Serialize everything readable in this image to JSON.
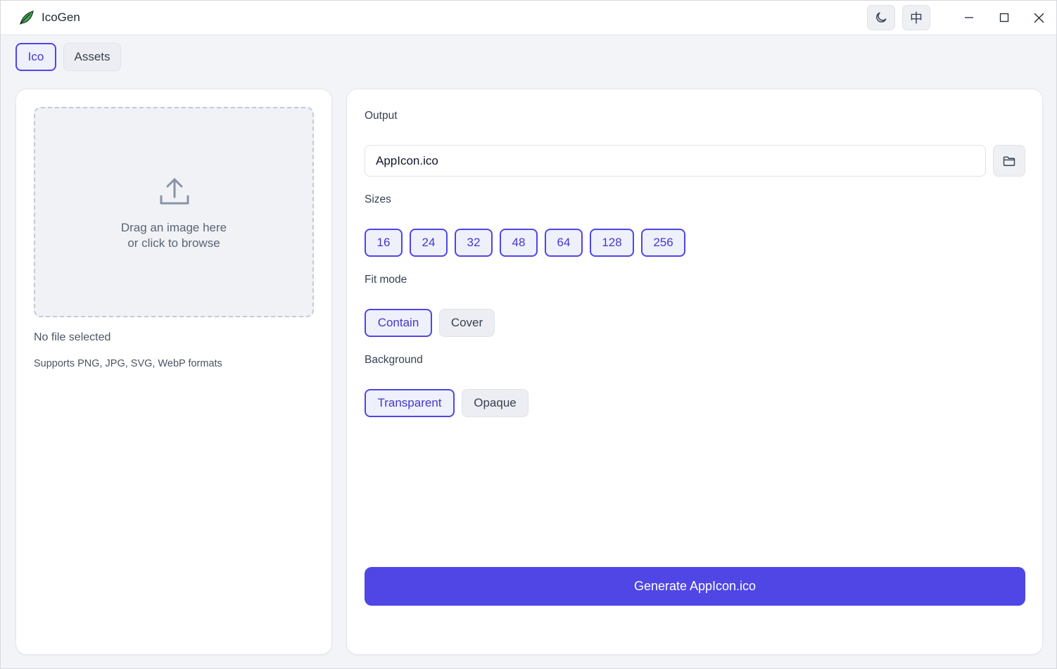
{
  "app": {
    "title": "IcoGen",
    "logo_icon": "leaf-icon",
    "lang_label": "中",
    "theme_icon": "moon-icon"
  },
  "tabs": [
    {
      "label": "Ico",
      "active": true
    },
    {
      "label": "Assets",
      "active": false
    }
  ],
  "left": {
    "drop_line1": "Drag an image here",
    "drop_line2": "or click to browse",
    "file_status": "No file selected",
    "formats": "Supports PNG, JPG, SVG, WebP formats"
  },
  "right": {
    "output_label": "Output",
    "output_value": "AppIcon.ico",
    "sizes_label": "Sizes",
    "sizes": [
      {
        "label": "16",
        "selected": true
      },
      {
        "label": "24",
        "selected": true
      },
      {
        "label": "32",
        "selected": true
      },
      {
        "label": "48",
        "selected": true
      },
      {
        "label": "64",
        "selected": true
      },
      {
        "label": "128",
        "selected": true
      },
      {
        "label": "256",
        "selected": true
      }
    ],
    "fit_label": "Fit mode",
    "fit_options": [
      {
        "label": "Contain",
        "selected": true
      },
      {
        "label": "Cover",
        "selected": false
      }
    ],
    "bg_label": "Background",
    "bg_options": [
      {
        "label": "Transparent",
        "selected": true
      },
      {
        "label": "Opaque",
        "selected": false
      }
    ],
    "generate_label": "Generate AppIcon.ico"
  },
  "colors": {
    "accent": "#4f46e5",
    "accent_bg": "#eef0fb",
    "window_bg": "#f3f4f8"
  }
}
